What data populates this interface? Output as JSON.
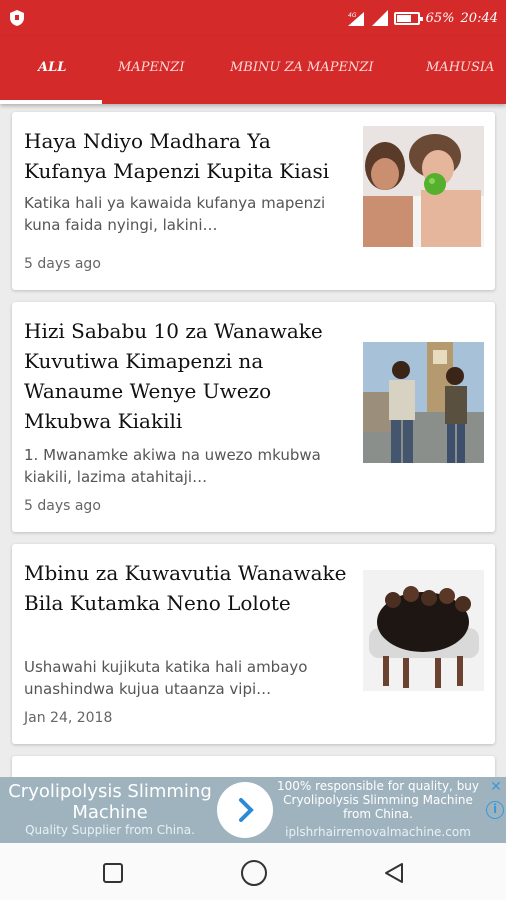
{
  "status": {
    "battery": "65%",
    "time": "20:44",
    "battery_level": 0.65
  },
  "tabs": [
    "ALL",
    "MAPENZI",
    "MBINU ZA MAPENZI",
    "MAHUSIA"
  ],
  "articles": [
    {
      "title": "Haya Ndiyo Madhara Ya Kufanya Mapenzi Kupita Kiasi",
      "excerpt": "Katika hali ya kawaida kufanya mapenzi kuna faida nyingi, lakini…",
      "date": "5 days ago",
      "image": "couple-apple-photo"
    },
    {
      "title": "Hizi Sababu 10 za Wanawake Kuvutiwa Kimapenzi na Wanaume Wenye Uwezo Mkubwa Kiakili",
      "excerpt": "1. Mwanamke akiwa na uwezo mkubwa kiakili, lazima atahitaji…",
      "date": "5 days ago",
      "image": "couple-big-ben-photo"
    },
    {
      "title": "Mbinu za Kuwavutia Wanawake Bila Kutamka Neno Lolote",
      "excerpt": "Ushawahi kujikuta katika hali ambayo unashindwa kujua utaanza vipi…",
      "date": "Jan 24, 2018",
      "image": "group-on-couch-photo"
    }
  ],
  "ad": {
    "headline": "Cryolipolysis Slimming Machine",
    "subline": "Quality Supplier from China.",
    "right_text": "100% responsible for quality, buy Cryolipolysis Slimming Machine from China.",
    "domain": "iplshrhairremovalmachine.com"
  }
}
